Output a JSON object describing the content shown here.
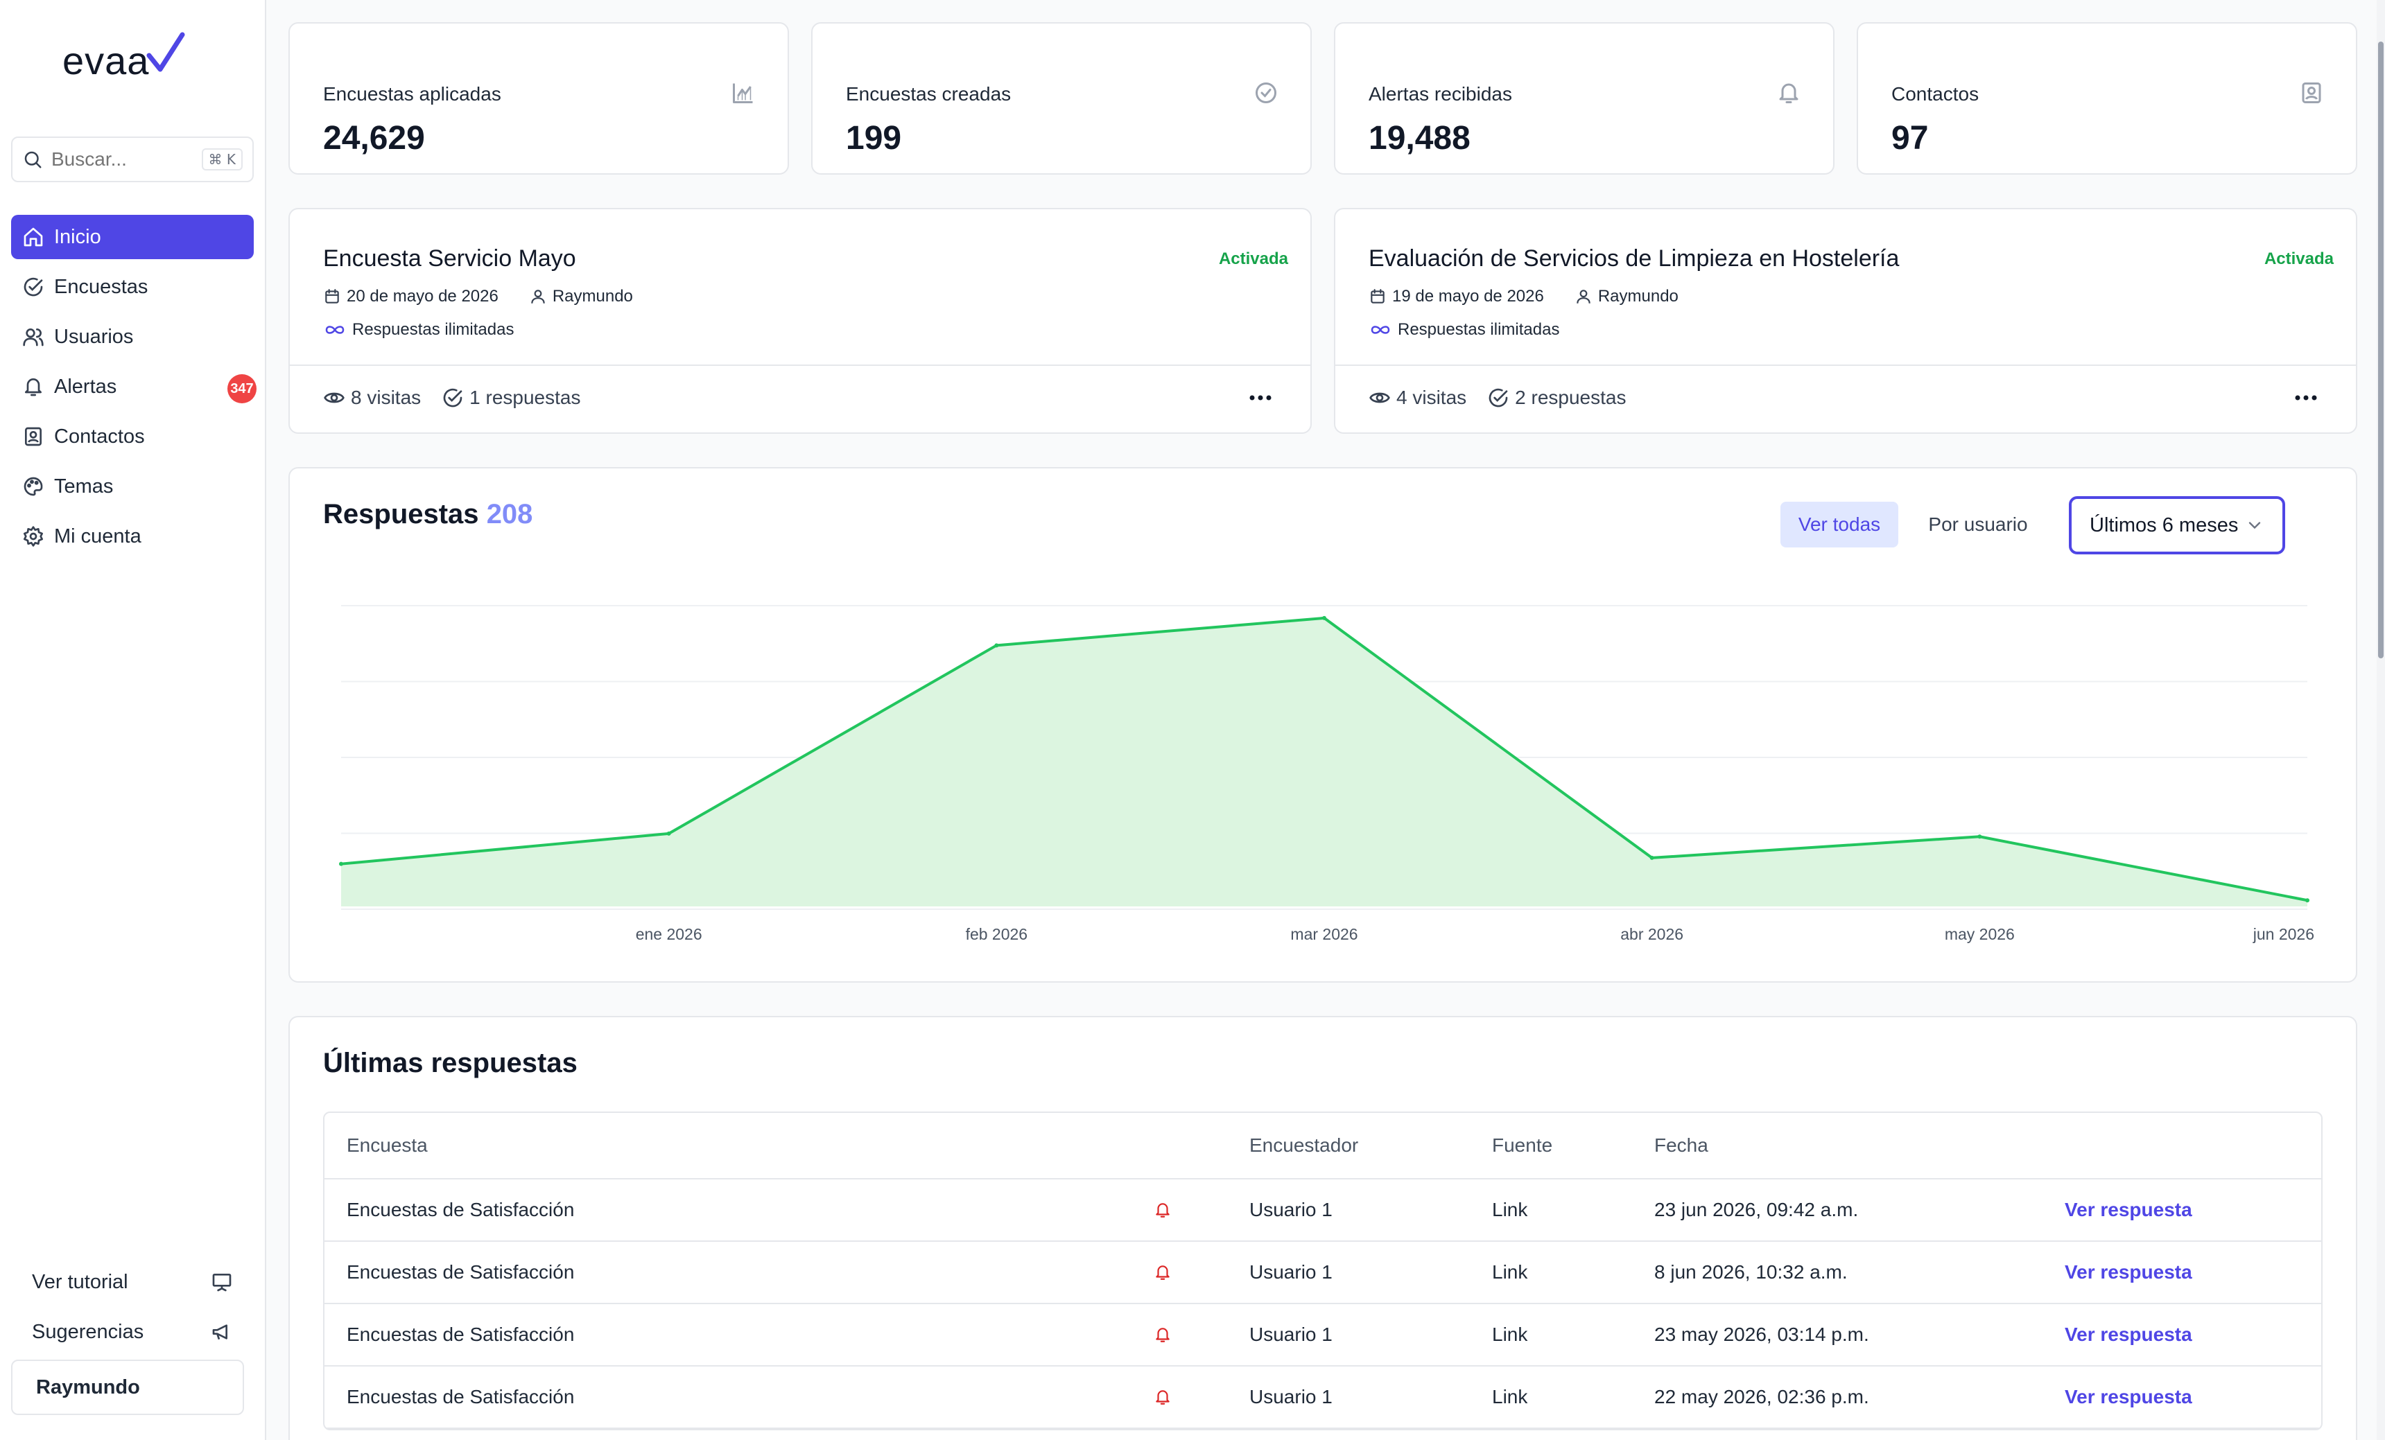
{
  "brand": {
    "name": "evaa",
    "accent": "#4f46e5"
  },
  "search": {
    "placeholder": "Buscar...",
    "shortcut": "⌘ K"
  },
  "nav": {
    "items": [
      {
        "label": "Inicio",
        "icon": "home-icon",
        "active": true
      },
      {
        "label": "Encuestas",
        "icon": "check-circle-icon"
      },
      {
        "label": "Usuarios",
        "icon": "users-icon"
      },
      {
        "label": "Alertas",
        "icon": "bell-icon",
        "badge": "347"
      },
      {
        "label": "Contactos",
        "icon": "contact-icon"
      },
      {
        "label": "Temas",
        "icon": "palette-icon"
      },
      {
        "label": "Mi cuenta",
        "icon": "gear-icon"
      }
    ]
  },
  "sidebar_bottom": {
    "tutorial": "Ver tutorial",
    "suggestions": "Sugerencias",
    "user": "Raymundo"
  },
  "stats": [
    {
      "label": "Encuestas aplicadas",
      "value": "24,629",
      "icon": "chart-icon"
    },
    {
      "label": "Encuestas creadas",
      "value": "199",
      "icon": "check-circle-icon"
    },
    {
      "label": "Alertas recibidas",
      "value": "19,488",
      "icon": "bell-icon"
    },
    {
      "label": "Contactos",
      "value": "97",
      "icon": "contact-icon"
    }
  ],
  "surveys": [
    {
      "title": "Encuesta Servicio Mayo",
      "status": "Activada",
      "date": "20 de mayo de 2026",
      "author": "Raymundo",
      "limit": "Respuestas ilimitadas",
      "visits": "8 visitas",
      "responses": "1 respuestas"
    },
    {
      "title": "Evaluación de Servicios de Limpieza en Hostelería",
      "status": "Activada",
      "date": "19 de mayo de 2026",
      "author": "Raymundo",
      "limit": "Respuestas ilimitadas",
      "visits": "4 visitas",
      "responses": "2 respuestas"
    }
  ],
  "responses_panel": {
    "title": "Respuestas",
    "count": "208",
    "btn_all": "Ver todas",
    "btn_user": "Por usuario",
    "period": "Últimos 6 meses"
  },
  "chart_data": {
    "type": "area",
    "x": [
      "",
      "ene 2026",
      "feb 2026",
      "mar 2026",
      "abr 2026",
      "may 2026",
      "jun 2026"
    ],
    "values": [
      14,
      24,
      86,
      95,
      16,
      23,
      2
    ],
    "ylim": [
      0,
      100
    ],
    "grid": true,
    "color": "#22c55e",
    "fill": "#dcf5e0"
  },
  "latest": {
    "title": "Últimas respuestas",
    "headers": {
      "survey": "Encuesta",
      "surveyor": "Encuestador",
      "source": "Fuente",
      "date": "Fecha"
    },
    "rows": [
      {
        "survey": "Encuestas de Satisfacción",
        "surveyor": "Usuario 1",
        "source": "Link",
        "date": "23 jun 2026, 09:42 a.m.",
        "action": "Ver respuesta"
      },
      {
        "survey": "Encuestas de Satisfacción",
        "surveyor": "Usuario 1",
        "source": "Link",
        "date": "8 jun 2026, 10:32 a.m.",
        "action": "Ver respuesta"
      },
      {
        "survey": "Encuestas de Satisfacción",
        "surveyor": "Usuario 1",
        "source": "Link",
        "date": "23 may 2026, 03:14 p.m.",
        "action": "Ver respuesta"
      },
      {
        "survey": "Encuestas de Satisfacción",
        "surveyor": "Usuario 1",
        "source": "Link",
        "date": "22 may 2026, 02:36 p.m.",
        "action": "Ver respuesta"
      }
    ]
  }
}
